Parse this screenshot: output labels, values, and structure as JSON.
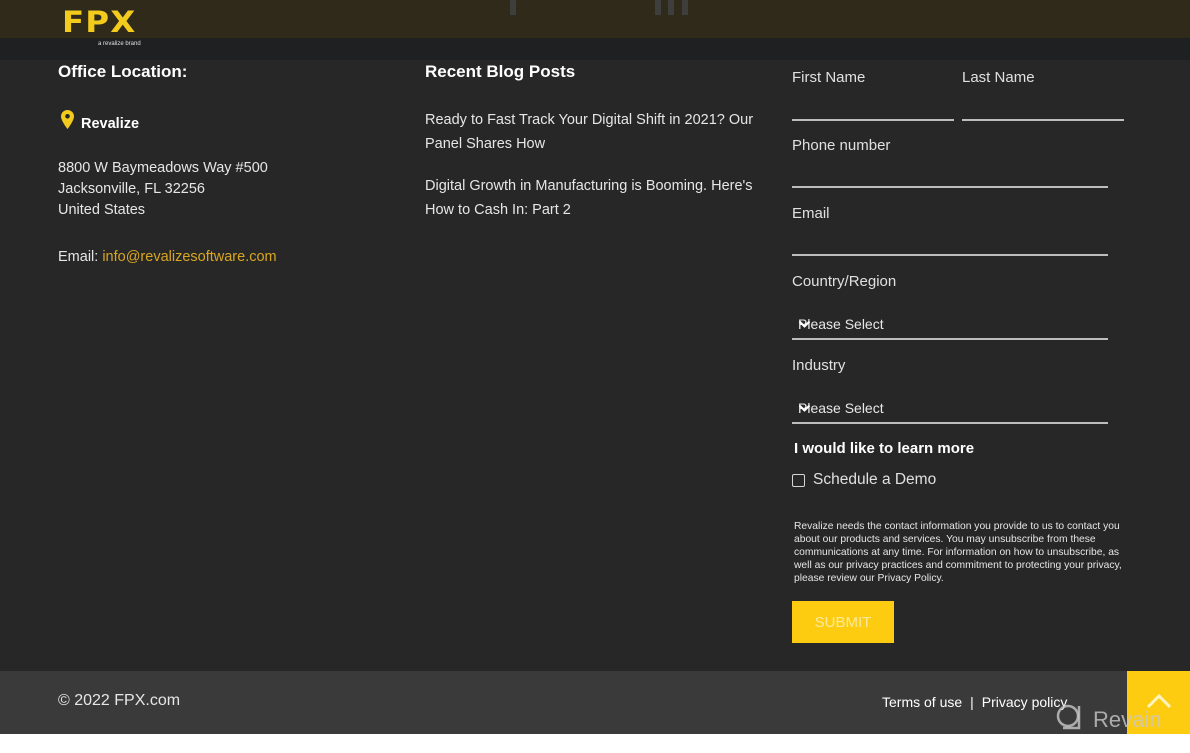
{
  "header": {
    "logo_text": "FPX",
    "logo_subtext": "a revalize brand"
  },
  "office": {
    "heading": "Office Location:",
    "company": "Revalize",
    "address_lines": [
      "8800 W Baymeadows Way #500",
      "Jacksonville, FL 32256",
      "United States"
    ],
    "email_label": "Email:",
    "email": "info@revalizesoftware.com"
  },
  "blog": {
    "heading": "Recent Blog Posts",
    "posts": [
      "Ready to Fast Track Your Digital Shift in 2021? Our Panel Shares How",
      "Digital Growth in Manufacturing is Booming. Here's How to Cash In: Part 2"
    ]
  },
  "form": {
    "first_name_label": "First Name",
    "last_name_label": "Last Name",
    "phone_label": "Phone number",
    "email_label": "Email",
    "country_label": "Country/Region",
    "country_value": "Please Select",
    "industry_label": "Industry",
    "industry_value": "Please Select",
    "learn_more_heading": "I would like to learn more",
    "demo_checkbox_label": "Schedule a Demo",
    "demo_checked": false,
    "legal_text": "Revalize needs the contact information you provide to us to contact you about our products and services. You may unsubscribe from these communications at any time. For information on how to unsubscribe, as well as our privacy practices and commitment to protecting your privacy, please review our Privacy Policy.",
    "submit_label": "SUBMIT"
  },
  "footer": {
    "copyright": "© 2022 FPX.com",
    "terms_label": "Terms of use",
    "separator": "|",
    "privacy_label": "Privacy policy"
  },
  "watermark": "Revain",
  "colors": {
    "accent": "#fdcc11",
    "link": "#d9a620",
    "background": "#272727",
    "footer": "#3a3a3a"
  }
}
